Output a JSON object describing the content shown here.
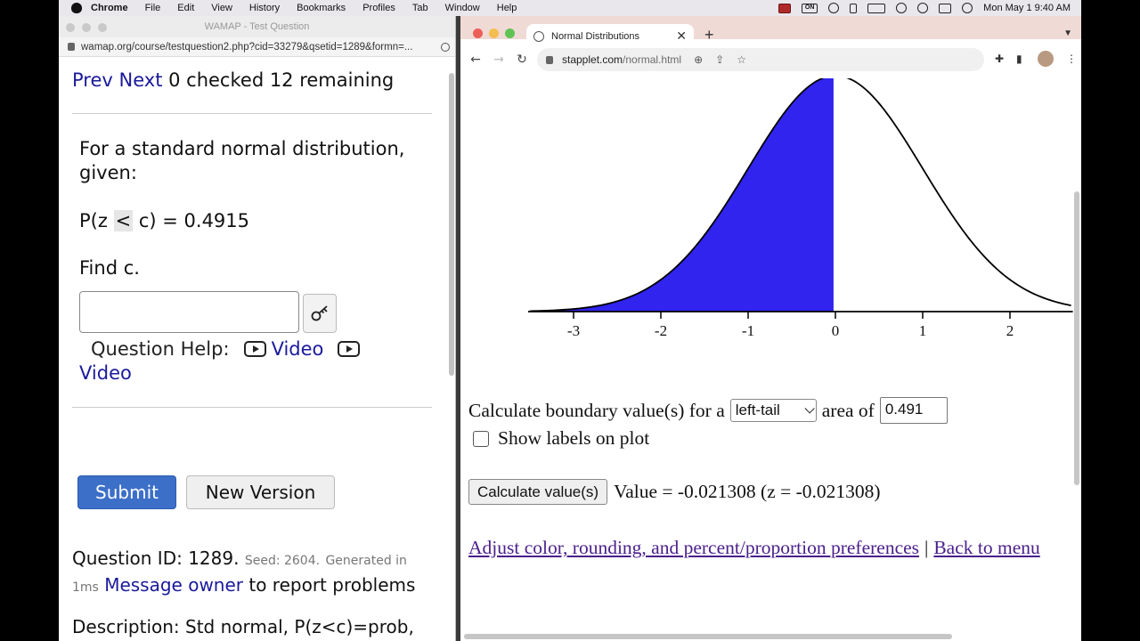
{
  "menubar": {
    "items": [
      "Chrome",
      "File",
      "Edit",
      "View",
      "History",
      "Bookmarks",
      "Profiles",
      "Tab",
      "Window",
      "Help"
    ],
    "status_tag": "ON",
    "datetime": "Mon May 1  9:40 AM"
  },
  "left_window": {
    "title": "WAMAP - Test Question",
    "url": "wamap.org/course/testquestion2.php?cid=33279&qsetid=1289&formn=...",
    "nav": {
      "prev": "Prev",
      "next": "Next",
      "status": "0 checked 12 remaining"
    },
    "question": {
      "prompt": "For a standard normal distribution, given:",
      "eq_prefix": "P(z ",
      "eq_symbol": "<",
      "eq_suffix": " c) = 0.4915",
      "task": "Find c."
    },
    "answer": {
      "value": ""
    },
    "help": {
      "label": "Question Help:",
      "video1": "Video",
      "video2": "Video"
    },
    "buttons": {
      "submit": "Submit",
      "new_version": "New Version"
    },
    "meta": {
      "qid": "Question ID: 1289.",
      "seed": "Seed: 2604.",
      "generated": "Generated in",
      "time": "1ms",
      "message_owner": "Message owner",
      "report": "to report problems"
    },
    "description": "Description: Std normal, P(z<c)=prob, find c"
  },
  "right_window": {
    "tab_title": "Normal Distributions",
    "url_host": "stapplet.com",
    "url_path": "/normal.html",
    "calc": {
      "prefix": "Calculate boundary value(s) for a",
      "tail": "left-tail",
      "area_of": "area of",
      "area": "0.491",
      "show_labels": "Show labels on plot",
      "button": "Calculate value(s)",
      "result": "Value = -0.021308 (z = -0.021308)"
    },
    "links": {
      "prefs": "Adjust color, rounding, and percent/proportion preferences",
      "separator": "|",
      "back": "Back to menu"
    }
  },
  "chart_data": {
    "type": "area",
    "title": "",
    "xlabel": "",
    "ylabel": "",
    "distribution": "standard normal",
    "x_ticks": [
      "-3",
      "-2",
      "-1",
      "0",
      "1",
      "2"
    ],
    "xlim": [
      -3.5,
      2.7
    ],
    "shaded_region": {
      "from": -3.5,
      "to": -0.021308,
      "side": "left-tail",
      "area": 0.491
    },
    "fill_color": "#3124ee",
    "curve_color": "#000000",
    "grid": false,
    "legend": "none"
  }
}
